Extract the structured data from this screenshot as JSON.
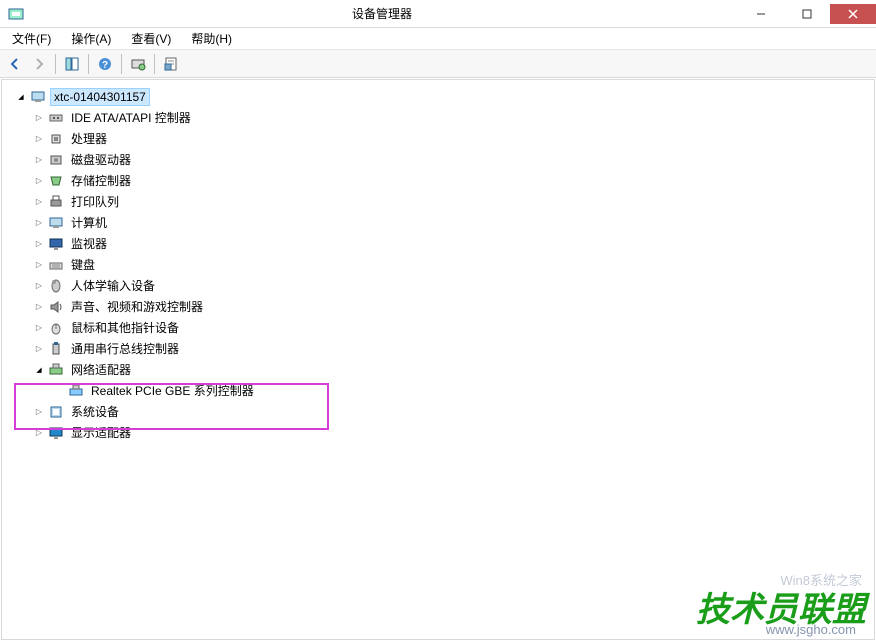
{
  "window": {
    "title": "设备管理器"
  },
  "menu": {
    "file": "文件(F)",
    "action": "操作(A)",
    "view": "查看(V)",
    "help": "帮助(H)"
  },
  "tree": {
    "root": "xtc-01404301157",
    "nodes": [
      {
        "label": "IDE ATA/ATAPI 控制器",
        "icon": "ide"
      },
      {
        "label": "处理器",
        "icon": "cpu"
      },
      {
        "label": "磁盘驱动器",
        "icon": "disk"
      },
      {
        "label": "存储控制器",
        "icon": "storage"
      },
      {
        "label": "打印队列",
        "icon": "printer"
      },
      {
        "label": "计算机",
        "icon": "computer"
      },
      {
        "label": "监视器",
        "icon": "monitor"
      },
      {
        "label": "键盘",
        "icon": "keyboard"
      },
      {
        "label": "人体学输入设备",
        "icon": "hid"
      },
      {
        "label": "声音、视频和游戏控制器",
        "icon": "sound"
      },
      {
        "label": "鼠标和其他指针设备",
        "icon": "mouse"
      },
      {
        "label": "通用串行总线控制器",
        "icon": "usb"
      }
    ],
    "network": {
      "label": "网络适配器",
      "child": "Realtek PCIe GBE 系列控制器"
    },
    "after": [
      {
        "label": "系统设备",
        "icon": "system"
      },
      {
        "label": "显示适配器",
        "icon": "display"
      }
    ]
  },
  "watermarks": {
    "main": "技术员联盟",
    "url": "www.jsgho.com",
    "faint": "Win8系统之家"
  }
}
